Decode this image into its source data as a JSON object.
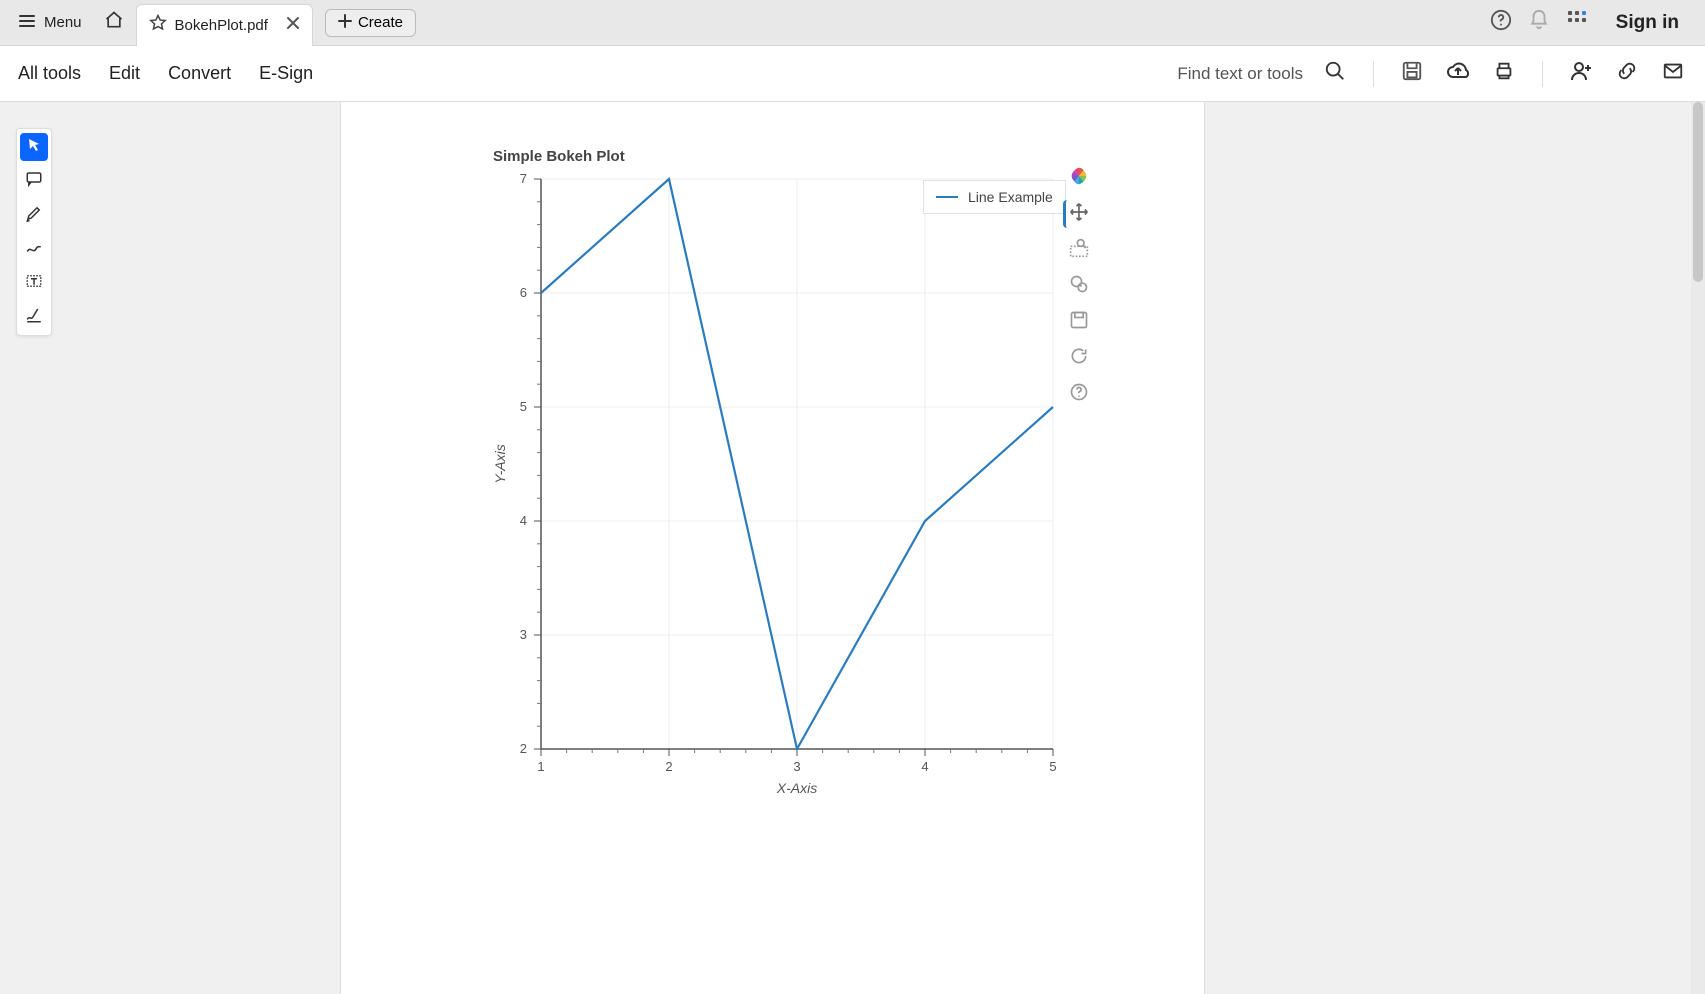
{
  "topbar": {
    "menu_label": "Menu",
    "tab_filename": "BokehPlot.pdf",
    "create_label": "Create",
    "signin_label": "Sign in"
  },
  "toolbar": {
    "all_tools": "All tools",
    "edit": "Edit",
    "convert": "Convert",
    "esign": "E-Sign",
    "find_placeholder": "Find text or tools"
  },
  "chart_data": {
    "type": "line",
    "title": "Simple Bokeh Plot",
    "xlabel": "X-Axis",
    "ylabel": "Y-Axis",
    "x": [
      1,
      2,
      3,
      4,
      5
    ],
    "y": [
      6,
      7,
      2,
      4,
      5
    ],
    "xlim": [
      1,
      5
    ],
    "ylim": [
      2,
      7
    ],
    "x_ticks": [
      1,
      2,
      3,
      4,
      5
    ],
    "y_ticks": [
      2,
      3,
      4,
      5,
      6,
      7
    ],
    "legend": [
      "Line Example"
    ]
  }
}
